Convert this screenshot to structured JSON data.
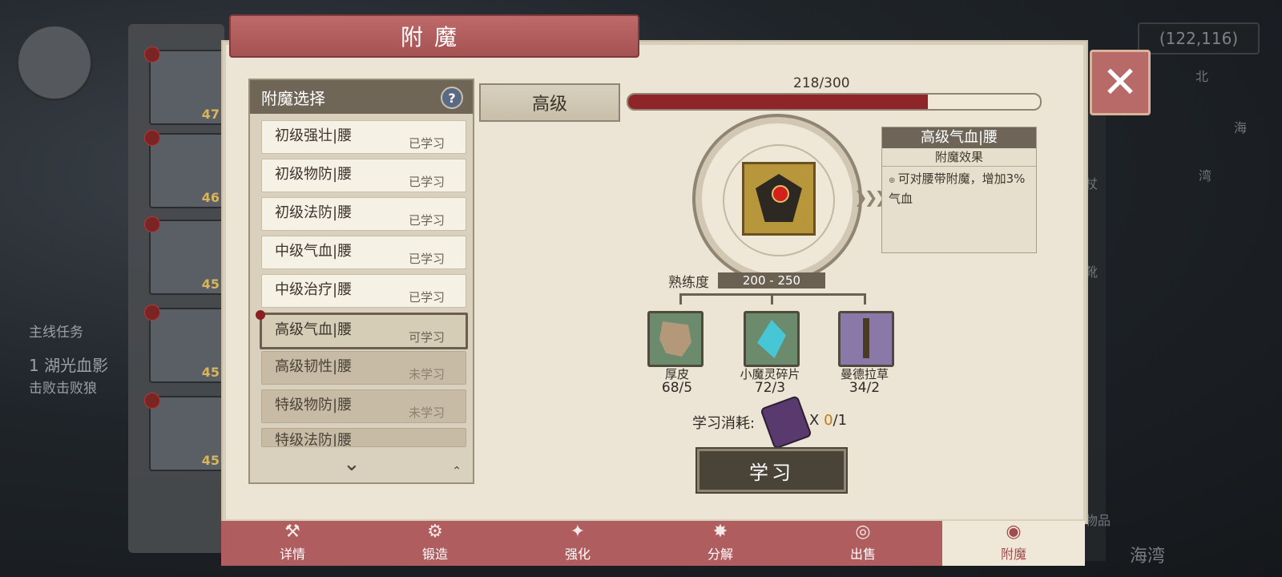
{
  "background": {
    "coords": "(122,116)",
    "hero_levels": [
      "47",
      "46",
      "45",
      "45",
      "45"
    ],
    "task_title": "主线任务",
    "task_name": "1 湖光血影",
    "task_desc": "击败击败狼",
    "right_labels": [
      "北",
      "海",
      "湾",
      "杖",
      "靴",
      "物品"
    ],
    "bay": "海湾"
  },
  "dialog": {
    "title": "附魔",
    "close_label": "✕"
  },
  "list": {
    "header": "附魔选择",
    "help": "?",
    "items": [
      {
        "name": "初级强壮|腰",
        "status": "已学习",
        "state": "learned"
      },
      {
        "name": "初级物防|腰",
        "status": "已学习",
        "state": "learned"
      },
      {
        "name": "初级法防|腰",
        "status": "已学习",
        "state": "learned"
      },
      {
        "name": "中级气血|腰",
        "status": "已学习",
        "state": "learned"
      },
      {
        "name": "中级治疗|腰",
        "status": "已学习",
        "state": "learned"
      },
      {
        "name": "高级气血|腰",
        "status": "可学习",
        "state": "selected"
      },
      {
        "name": "高级韧性|腰",
        "status": "未学习",
        "state": "locked"
      },
      {
        "name": "特级物防|腰",
        "status": "未学习",
        "state": "locked"
      },
      {
        "name": "特级法防|腰",
        "status": "",
        "state": "locked"
      }
    ]
  },
  "tier": {
    "label": "高级",
    "exp_text": "218/300",
    "exp_fraction": 0.7267
  },
  "effect": {
    "title": "高级气血|腰",
    "subtitle": "附魔效果",
    "text": "可对腰带附魔，增加3%气血"
  },
  "proficiency": {
    "label": "熟练度",
    "value": "200 - 250"
  },
  "materials": [
    {
      "name": "厚皮",
      "count": "68/5",
      "icon": "leather-icon"
    },
    {
      "name": "小魔灵碎片",
      "count": "72/3",
      "icon": "crystal-shard-icon"
    },
    {
      "name": "曼德拉草",
      "count": "34/2",
      "icon": "mandrake-icon"
    }
  ],
  "cost": {
    "label": "学习消耗:",
    "times": "X",
    "have": "0",
    "need": "/1"
  },
  "learn_button": "学习",
  "tabs": [
    {
      "label": "详情",
      "icon": "⚒"
    },
    {
      "label": "锻造",
      "icon": "⚙"
    },
    {
      "label": "强化",
      "icon": "✦"
    },
    {
      "label": "分解",
      "icon": "✸"
    },
    {
      "label": "出售",
      "icon": "◎"
    },
    {
      "label": "附魔",
      "icon": "◉"
    }
  ],
  "colors": {
    "accent_red": "#8e2529",
    "tab_bar": "#b05d60",
    "parchment": "#ece5d5"
  }
}
